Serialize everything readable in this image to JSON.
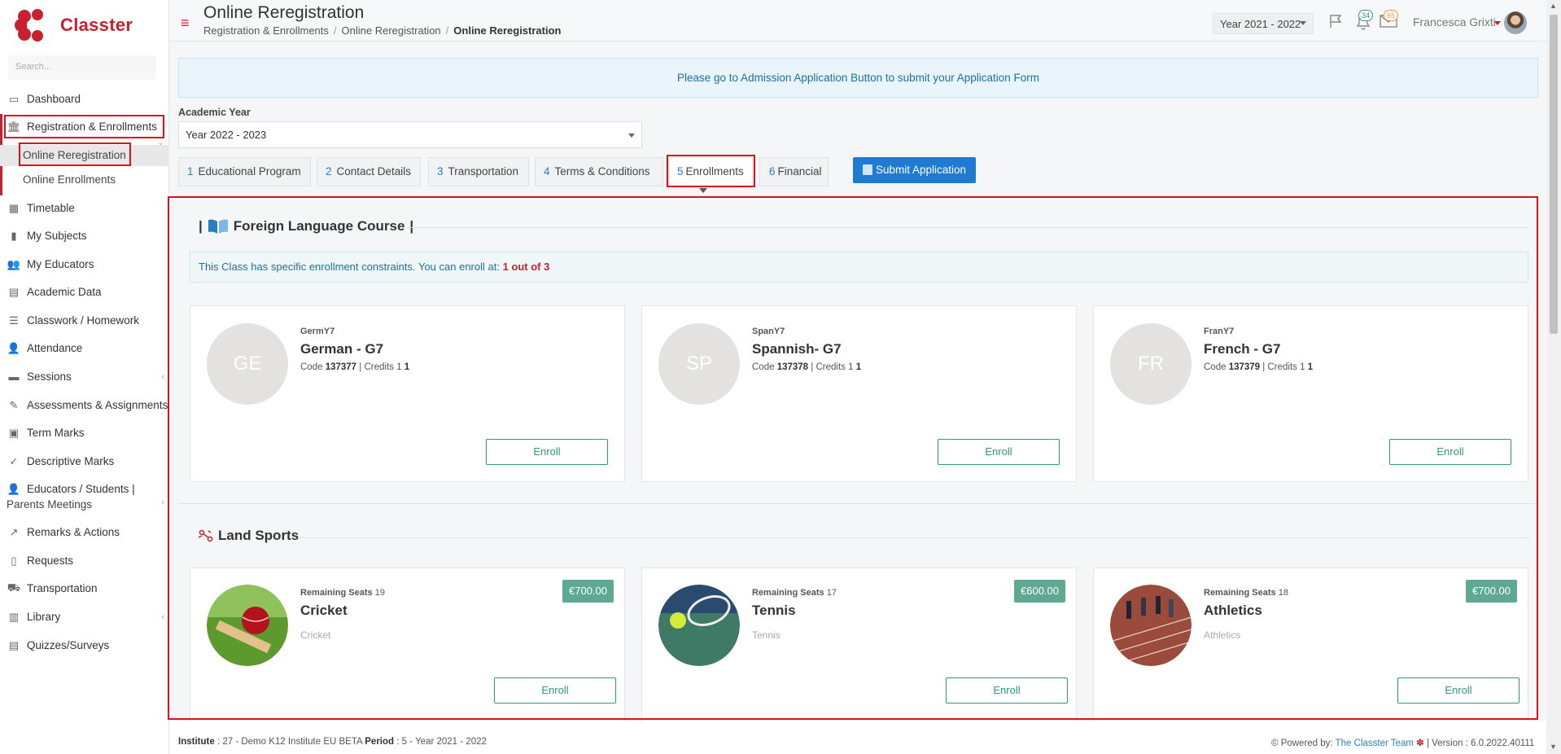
{
  "app": {
    "name": "Classter"
  },
  "search": {
    "placeholder": "Search..."
  },
  "sidebar": {
    "items": [
      {
        "label": "Dashboard"
      },
      {
        "label": "Registration & Enrollments"
      },
      {
        "label": "Online Reregistration"
      },
      {
        "label": "Online Enrollments"
      },
      {
        "label": "Timetable"
      },
      {
        "label": "My Subjects"
      },
      {
        "label": "My Educators"
      },
      {
        "label": "Academic Data"
      },
      {
        "label": "Classwork / Homework"
      },
      {
        "label": "Attendance"
      },
      {
        "label": "Sessions"
      },
      {
        "label": "Assessments & Assignments"
      },
      {
        "label": "Term Marks"
      },
      {
        "label": "Descriptive Marks"
      },
      {
        "label": "Educators / Students |"
      },
      {
        "label": "Parents Meetings"
      },
      {
        "label": "Remarks & Actions"
      },
      {
        "label": "Requests"
      },
      {
        "label": "Transportation"
      },
      {
        "label": "Library"
      },
      {
        "label": "Quizzes/Surveys"
      }
    ]
  },
  "header": {
    "title": "Online Reregistration",
    "breadcrumb": [
      "Registration & Enrollments",
      "Online Reregistration",
      "Online Reregistration"
    ],
    "year": "Year 2021 - 2022",
    "notifications_count": "34",
    "messages_count": "65",
    "user_name": "Francesca Grixti"
  },
  "banner": {
    "text": "Please go to Admission Application Button to submit your Application Form"
  },
  "academic_year": {
    "label": "Academic Year",
    "value": "Year 2022 - 2023"
  },
  "tabs": [
    {
      "num": "1",
      "label": "Educational Program"
    },
    {
      "num": "2",
      "label": "Contact Details"
    },
    {
      "num": "3",
      "label": "Transportation"
    },
    {
      "num": "4",
      "label": "Terms & Conditions"
    },
    {
      "num": "5",
      "label": "Enrollments"
    },
    {
      "num": "6",
      "label": "Financial"
    }
  ],
  "submit_label": "Submit Application",
  "language_section": {
    "title": "Foreign Language Course",
    "constraint_text": "This Class has specific enrollment constraints. You can enroll at: ",
    "constraint_value": "1 out of 3",
    "courses": [
      {
        "initials": "GE",
        "short": "GermY7",
        "name": "German - G7",
        "code": "137377",
        "credits": "1"
      },
      {
        "initials": "SP",
        "short": "SpanY7",
        "name": "Spannish- G7",
        "code": "137378",
        "credits": "1"
      },
      {
        "initials": "FR",
        "short": "FranY7",
        "name": "French - G7",
        "code": "137379",
        "credits": "1"
      }
    ]
  },
  "sports_section": {
    "title": "Land Sports",
    "seats_label": "Remaining Seats",
    "activities": [
      {
        "seats": "19",
        "name": "Cricket",
        "desc": "Cricket",
        "price": "€700.00"
      },
      {
        "seats": "17",
        "name": "Tennis",
        "desc": "Tennis",
        "price": "€600.00"
      },
      {
        "seats": "18",
        "name": "Athletics",
        "desc": "Athletics",
        "price": "€700.00"
      }
    ]
  },
  "labels": {
    "code": "Code",
    "credits": "Credits",
    "enroll": "Enroll"
  },
  "footer": {
    "institute_label": "Institute",
    "institute_value": ": 27 - Demo K12 Institute EU BETA",
    "period_label": "Period",
    "period_value": ": 5 - Year 2021 - 2022",
    "powered": "Powered by:",
    "team": "The Classter Team",
    "version": "| Version : 6.0.2022.40111"
  }
}
